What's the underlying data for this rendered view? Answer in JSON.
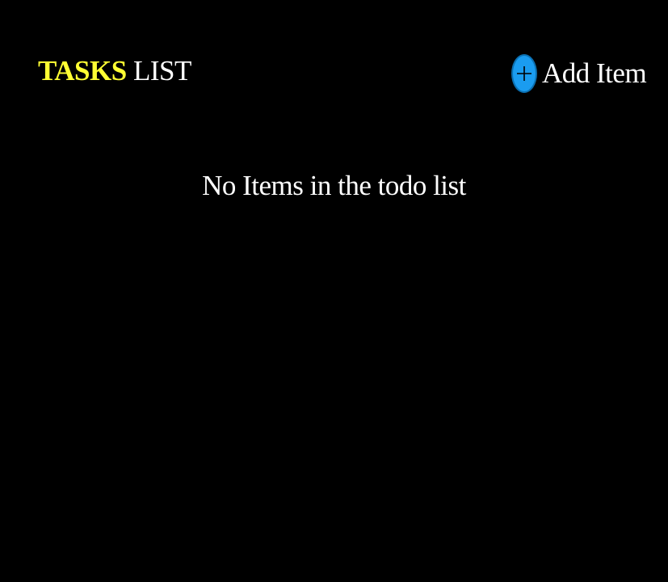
{
  "header": {
    "title_accent": "TASKS",
    "title_rest": " LIST",
    "add_label": "Add Item",
    "add_icon": "plus-icon"
  },
  "main": {
    "empty_message": "No Items in the todo list"
  },
  "colors": {
    "background": "#000000",
    "accent": "#ffff33",
    "text": "#ffffff",
    "add_button": "#1a9cf0"
  }
}
